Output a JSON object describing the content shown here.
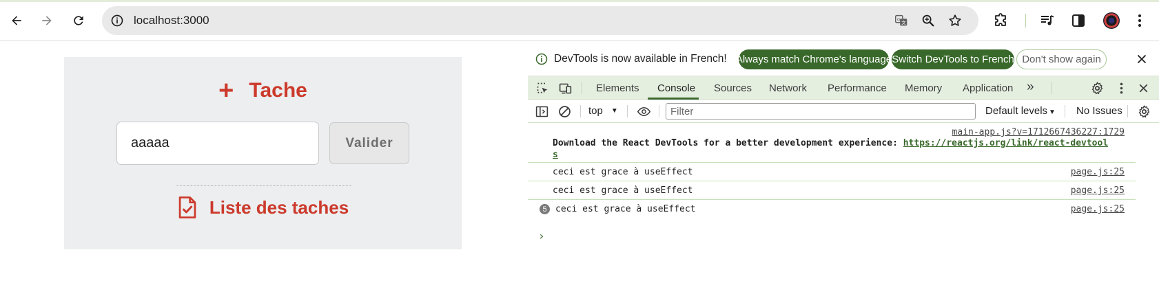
{
  "browser": {
    "url": "localhost:3000",
    "icons": {
      "back": "arrow-left-icon",
      "forward": "arrow-right-icon",
      "reload": "reload-icon",
      "site_info": "site-info-icon",
      "translate": "translate-icon",
      "zoom": "zoom-icon",
      "bookmark": "star-icon",
      "extensions": "puzzle-icon",
      "media": "media-control-icon",
      "side_panel": "side-panel-icon",
      "menu": "kebab-menu-icon"
    }
  },
  "app": {
    "add_title": "Tache",
    "input_value": "aaaaa",
    "submit_label": "Valider",
    "list_title": "Liste des taches",
    "accent_color": "#cc3a2c"
  },
  "devtools": {
    "infobar": {
      "message": "DevTools is now available in French!",
      "btn_match": "Always match Chrome's language",
      "btn_switch": "Switch DevTools to French",
      "btn_dismiss": "Don't show again"
    },
    "tabs": [
      "Elements",
      "Console",
      "Sources",
      "Network",
      "Performance",
      "Memory",
      "Application"
    ],
    "active_tab": "Console",
    "more_tabs": "»",
    "context": "top",
    "filter_placeholder": "Filter",
    "levels": "Default levels",
    "issues": "No Issues",
    "accent_color": "#38682a",
    "messages": [
      {
        "source": "main-app.js?v=1712667436227:1729",
        "text": "Download the React DevTools for a better development experience: ",
        "link_line1": "https://reactjs.org/link/react-devtool",
        "link_line2": "s"
      },
      {
        "source": "page.js:25",
        "text": "ceci est grace à useEffect"
      },
      {
        "source": "page.js:25",
        "text": "ceci est grace à useEffect"
      },
      {
        "source": "page.js:25",
        "text": "ceci est grace à useEffect",
        "repeat": "5"
      }
    ],
    "prompt": "›"
  }
}
